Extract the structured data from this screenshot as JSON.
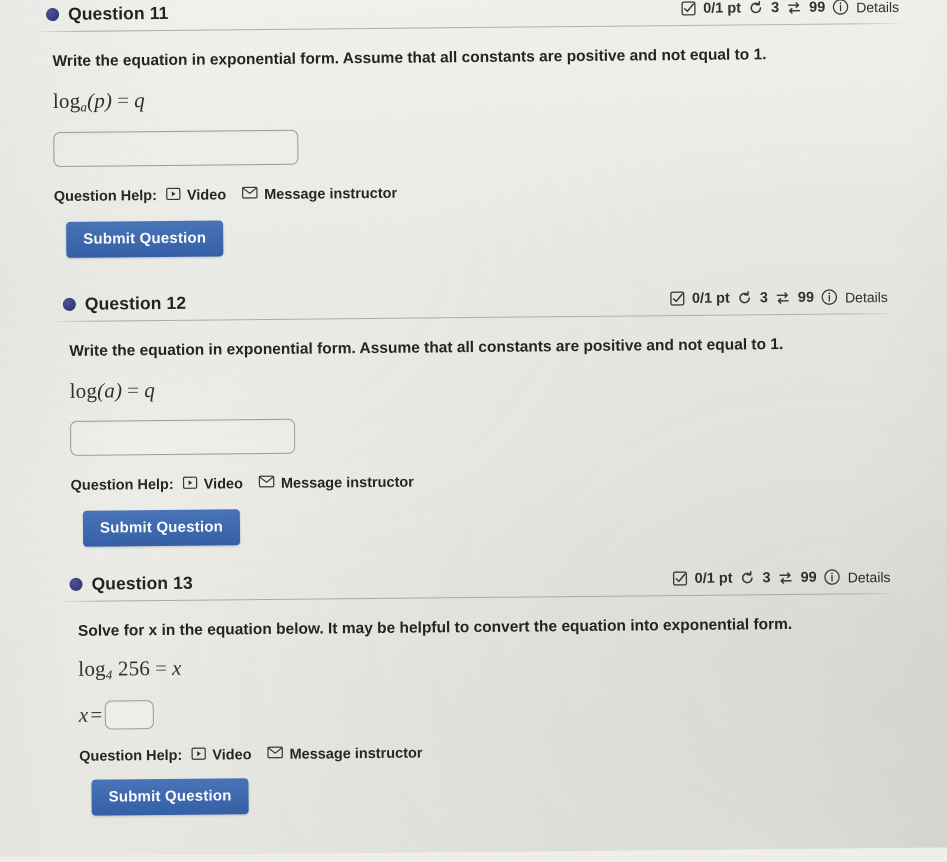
{
  "page": {
    "background_color": "#eeeeea",
    "accent_color": "#2f5ca6",
    "bullet_color": "#2c3479"
  },
  "questions": [
    {
      "title": "Question 11",
      "badges": {
        "points": "0/1 pt",
        "attempts": "3",
        "versions": "99",
        "details": "Details",
        "checkbox_icon": "checkbox-check-icon",
        "retry_icon": "retry-arrow-icon",
        "shuffle_icon": "swap-arrows-icon",
        "info_icon": "info-circle-icon"
      },
      "prompt": "Write the equation in exponential form. Assume that all constants are positive and not equal to 1.",
      "equation": {
        "func": "log",
        "base": "a",
        "arg": "(p)",
        "equals": "=",
        "rhs": "q"
      },
      "answer_value": "",
      "answer_placeholder": "",
      "help_label": "Question Help:",
      "video_label": "Video",
      "video_icon": "play-box-icon",
      "message_label": "Message instructor",
      "message_icon": "envelope-icon",
      "submit_label": "Submit Question"
    },
    {
      "title": "Question 12",
      "badges": {
        "points": "0/1 pt",
        "attempts": "3",
        "versions": "99",
        "details": "Details",
        "checkbox_icon": "checkbox-check-icon",
        "retry_icon": "retry-arrow-icon",
        "shuffle_icon": "swap-arrows-icon",
        "info_icon": "info-circle-icon"
      },
      "prompt": "Write the equation in exponential form. Assume that all constants are positive and not equal to 1.",
      "equation": {
        "func": "log",
        "base": "",
        "arg": "(a)",
        "equals": "=",
        "rhs": "q"
      },
      "answer_value": "",
      "answer_placeholder": "",
      "help_label": "Question Help:",
      "video_label": "Video",
      "video_icon": "play-box-icon",
      "message_label": "Message instructor",
      "message_icon": "envelope-icon",
      "submit_label": "Submit Question"
    },
    {
      "title": "Question 13",
      "badges": {
        "points": "0/1 pt",
        "attempts": "3",
        "versions": "99",
        "details": "Details",
        "checkbox_icon": "checkbox-check-icon",
        "retry_icon": "retry-arrow-icon",
        "shuffle_icon": "swap-arrows-icon",
        "info_icon": "info-circle-icon"
      },
      "prompt": "Solve for x in the equation below. It may be helpful to convert the equation into exponential form.",
      "equation": {
        "func": "log",
        "base": "4",
        "arg": "256",
        "equals": "=",
        "rhs": "x"
      },
      "answer_prefix": "x",
      "answer_prefix_equals": "=",
      "answer_value": "",
      "answer_placeholder": "",
      "help_label": "Question Help:",
      "video_label": "Video",
      "video_icon": "play-box-icon",
      "message_label": "Message instructor",
      "message_icon": "envelope-icon",
      "submit_label": "Submit Question"
    }
  ]
}
